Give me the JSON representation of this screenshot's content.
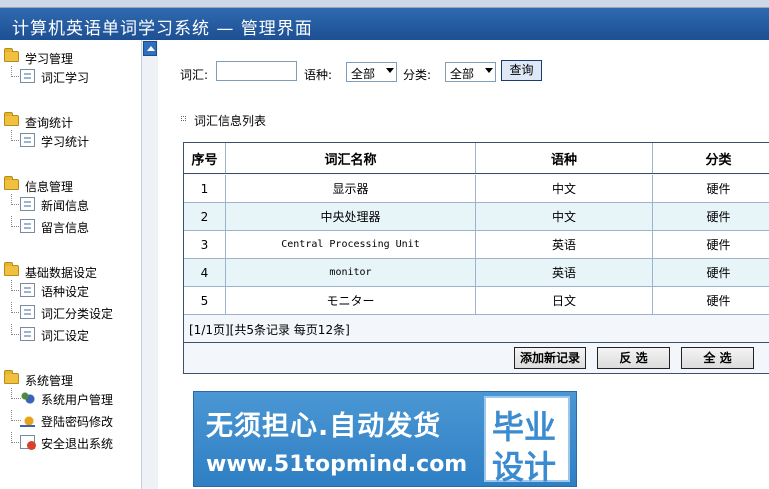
{
  "header": {
    "title": "计算机英语单词学习系统 — 管理界面"
  },
  "sidebar": {
    "groups": [
      {
        "title": "学习管理",
        "items": [
          "词汇学习"
        ]
      },
      {
        "title": "查询统计",
        "items": [
          "学习统计"
        ]
      },
      {
        "title": "信息管理",
        "items": [
          "新闻信息",
          "留言信息"
        ]
      },
      {
        "title": "基础数据设定",
        "items": [
          "语种设定",
          "词汇分类设定",
          "词汇设定"
        ]
      },
      {
        "title": "系统管理",
        "items": [
          "系统用户管理",
          "登陆密码修改",
          "安全退出系统"
        ]
      }
    ]
  },
  "filter": {
    "word_label": "词汇:",
    "word_value": "",
    "lang_label": "语种:",
    "lang_selected": "全部",
    "category_label": "分类:",
    "category_selected": "全部",
    "query_button": "查询"
  },
  "list_title": "词汇信息列表",
  "table": {
    "columns": [
      "序号",
      "词汇名称",
      "语种",
      "分类"
    ],
    "rows": [
      [
        "1",
        "显示器",
        "中文",
        "硬件"
      ],
      [
        "2",
        "中央处理器",
        "中文",
        "硬件"
      ],
      [
        "3",
        "Central Processing Unit",
        "英语",
        "硬件"
      ],
      [
        "4",
        "monitor",
        "英语",
        "硬件"
      ],
      [
        "5",
        "モニター",
        "日文",
        "硬件"
      ]
    ],
    "page_info": "[1/1页][共5条记录 每页12条]",
    "buttons": {
      "add": "添加新记录",
      "invert": "反 选",
      "select_all": "全 选"
    }
  },
  "banner": {
    "line1": "无须担心.自动发货",
    "line2": "www.51topmind.com",
    "badge_top": "毕业",
    "badge_bottom": "设计"
  }
}
